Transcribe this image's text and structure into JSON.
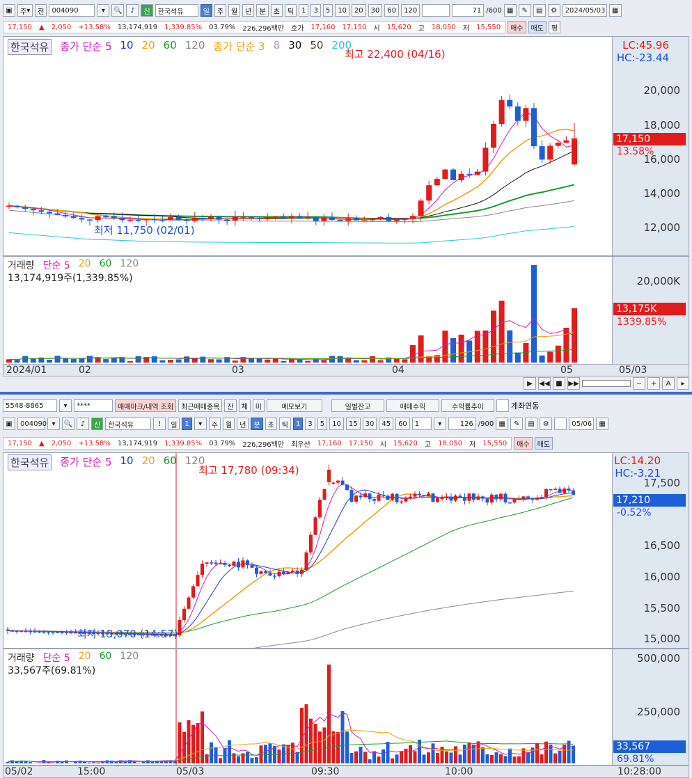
{
  "top": {
    "toolbar": {
      "mode": "주",
      "prev": "전",
      "code": "004090",
      "new_badge": "신",
      "name": "한국석유",
      "periods": [
        "일",
        "주",
        "월",
        "년",
        "분",
        "초",
        "틱"
      ],
      "nums": [
        "1",
        "3",
        "5",
        "10",
        "20",
        "30",
        "60",
        "120"
      ],
      "count": "71",
      "max": "/600",
      "date": "2024/05/03"
    },
    "info": {
      "price": "17,150",
      "change": "2,050",
      "pct": "+13.58%",
      "vol": "13,174,919",
      "volpct": "1,339.85%",
      "rate": "03.79%",
      "amt": "226,296백만",
      "quote_lbl": "호가",
      "q1": "17,160",
      "q2": "17,150",
      "open_lbl": "시",
      "open": "15,620",
      "high_lbl": "고",
      "high": "18,050",
      "low_lbl": "저",
      "low": "15,550",
      "buy": "매수",
      "sell": "매도",
      "flat": "평"
    },
    "legend": {
      "name": "한국석유",
      "ma_label": "종가 단순 5",
      "ma10": "10",
      "ma20": "20",
      "ma60": "60",
      "ma120": "120",
      "ma2_label": "종가 단순 3",
      "ma2_8": "8",
      "ma2_30": "30",
      "ma2_50": "50",
      "ma2_200": "200"
    },
    "lc": "LC:45.96",
    "hc": "HC:-23.44",
    "yticks": [
      "20,000",
      "18,000",
      "16,000",
      "14,000",
      "12,000"
    ],
    "price_badge": "17,150",
    "pct_badge": "13.58%",
    "high_note": "최고 22,400 (04/16)",
    "low_note": "최저 11,750 (02/01)",
    "vol_legend": {
      "label": "거래량",
      "ma": "단순 5",
      "m20": "20",
      "m60": "60",
      "m120": "120",
      "vol_text": "13,174,919주(1,339.85%)"
    },
    "vol_ytick": "20,000K",
    "vol_badge": "13,175K",
    "vol_pct": "1339.85%",
    "xticks": [
      "2024/01",
      "02",
      "03",
      "04",
      "05",
      "05/03"
    ]
  },
  "bottom": {
    "acct": {
      "num": "5548-8865",
      "pwd": "****",
      "b1": "매매마크/내역 조회",
      "b2": "최근매매종목",
      "b3": "잔",
      "b4": "체",
      "b5": "미",
      "b6": "메모보기",
      "b7": "일별잔고",
      "b8": "매매수익",
      "b9": "수익률추이",
      "b10": "계좌연동"
    },
    "toolbar": {
      "code": "004090",
      "new_badge": "신",
      "name": "한국석유",
      "mode": "일",
      "one": "1",
      "periods": [
        "주",
        "월",
        "년",
        "분",
        "초",
        "틱"
      ],
      "nums": [
        "1",
        "3",
        "5",
        "10",
        "15",
        "30",
        "45",
        "60"
      ],
      "sel": "1",
      "count": "126",
      "max": "/900",
      "date": "05/06"
    },
    "info": {
      "price": "17,150",
      "change": "2,050",
      "pct": "+13.58%",
      "vol": "13,174,919",
      "volpct": "1,339.85%",
      "rate": "03.79%",
      "amt": "226,296백만",
      "quote_lbl": "최우선",
      "q1": "17,160",
      "q2": "17,150",
      "open_lbl": "시",
      "open": "15,620",
      "high_lbl": "고",
      "high": "18,050",
      "low_lbl": "저",
      "low": "15,550",
      "buy": "매수",
      "sell": "매도"
    },
    "legend": {
      "name": "한국석유",
      "ma_label": "종가 단순 5",
      "ma10": "10",
      "ma20": "20",
      "ma60": "60",
      "ma120": "120"
    },
    "lc": "LC:14.20",
    "hc": "HC:-3.21",
    "yticks": [
      "17,500",
      "16,500",
      "16,000",
      "15,500",
      "15,000"
    ],
    "price_badge": "17,210",
    "pct_badge": "-0.52%",
    "high_note": "최고 17,780 (09:34)",
    "low_note": "최저 15,070 (14:57)",
    "vol_legend": {
      "label": "거래량",
      "ma": "단순 5",
      "m20": "20",
      "m60": "60",
      "m120": "120",
      "vol_text": "33,567주(69.81%)"
    },
    "vol_ytick1": "500,000",
    "vol_ytick2": "250,000",
    "vol_badge": "33,567",
    "vol_pct": "69.81%",
    "xticks": [
      "05/02",
      "15:00",
      "05/03",
      "09:30",
      "10:00",
      "10:28:00"
    ]
  },
  "colors": {
    "up": "#e01c1c",
    "down": "#1c5fd8",
    "ma5": "#d01cb8",
    "ma10": "#1c3fae",
    "ma20": "#e8a010",
    "ma60": "#1a9a2a",
    "ma120": "#888888"
  }
}
